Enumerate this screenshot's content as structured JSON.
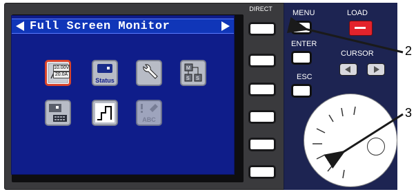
{
  "screen": {
    "title": "Full Screen Monitor",
    "icons": [
      {
        "name": "meter-icon",
        "line1": "10.00V",
        "line2": "20.0A",
        "selected": true
      },
      {
        "name": "status-icon",
        "label": "Status"
      },
      {
        "name": "wrench-icon"
      },
      {
        "name": "memory-icon"
      },
      {
        "name": "keypad-icon"
      },
      {
        "name": "sequence-icon"
      },
      {
        "name": "abc-edit-icon",
        "label": "ABC"
      }
    ]
  },
  "soft_keys": {
    "direct_label": "DIRECT",
    "count": 6
  },
  "controls": {
    "menu_label": "MENU",
    "load_label": "LOAD",
    "enter_label": "ENTER",
    "cursor_label": "CURSOR",
    "esc_label": "ESC"
  },
  "callouts": {
    "menu_callout": "2",
    "knob_callout": "3"
  },
  "colors": {
    "screen_bg": "#0f1d8a",
    "title_bar": "#1036b8",
    "load_button": "#e3232c",
    "right_panel": "#1d2452"
  }
}
